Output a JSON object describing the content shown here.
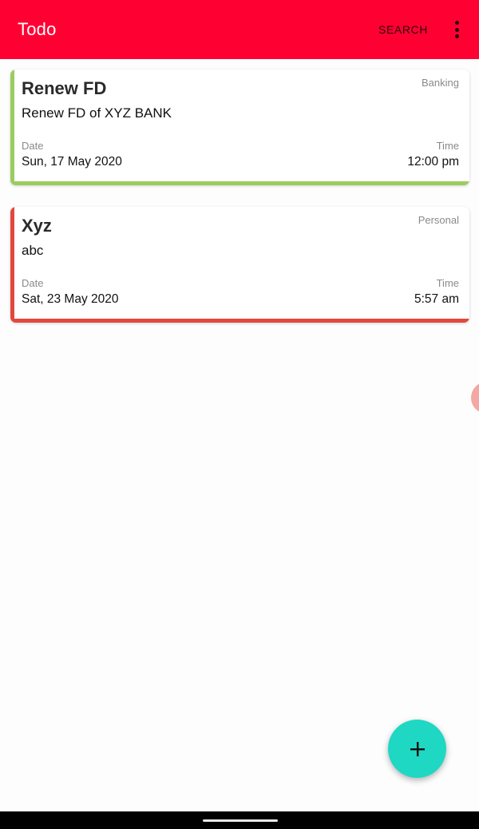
{
  "app_bar": {
    "title": "Todo",
    "search_label": "SEARCH",
    "overflow_icon": "more-vert-icon",
    "background": "#ff0033"
  },
  "todos": [
    {
      "title": "Renew FD",
      "category": "Banking",
      "description": "Renew FD of XYZ BANK",
      "date_label": "Date",
      "date": "Sun, 17 May 2020",
      "time_label": "Time",
      "time": "12:00 pm",
      "accent_color": "#9bcc5f"
    },
    {
      "title": "Xyz",
      "category": "Personal",
      "description": "abc",
      "date_label": "Date",
      "date": "Sat, 23 May 2020",
      "time_label": "Time",
      "time": "5:57 am",
      "accent_color": "#e2483d"
    }
  ],
  "fab": {
    "icon": "plus-icon",
    "background": "#1ed8c3"
  },
  "system_nav": {
    "home_indicator": "home-pill"
  }
}
